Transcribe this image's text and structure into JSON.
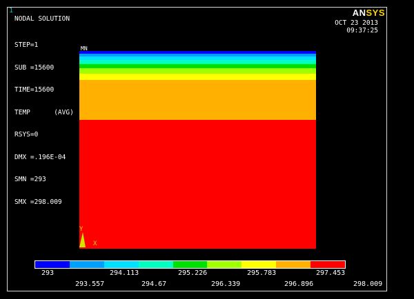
{
  "window_number": "1",
  "title": "NODAL SOLUTION",
  "info_lines": [
    "STEP=1",
    "SUB =15600",
    "TIME=15600",
    "TEMP      (AVG)",
    "RSYS=0",
    "DMX =.196E-04",
    "SMN =293",
    "SMX =298.009"
  ],
  "brand": {
    "part1": "AN",
    "part2": "SYS"
  },
  "date": "OCT 23 2013",
  "time": "09:37:25",
  "min_marker": "MN",
  "triad": {
    "y": "Y",
    "x": "X",
    "z": "X"
  },
  "contour_colors": [
    "#0000ff",
    "#00a0ff",
    "#00e0ff",
    "#00ffc0",
    "#00e000",
    "#a0ff00",
    "#ffff00",
    "#ffb000",
    "#ff0000"
  ],
  "legend": {
    "levels_top": [
      "293",
      "294.113",
      "294.67",
      "295.783",
      "296.896",
      "298.009"
    ],
    "levels_bottom": [
      "293.557",
      "295.226",
      "296.339",
      "297.453"
    ]
  },
  "legend_values": [
    "293",
    "293.557",
    "294.113",
    "294.67",
    "295.226",
    "295.783",
    "296.339",
    "296.896",
    "297.453",
    "298.009"
  ]
}
